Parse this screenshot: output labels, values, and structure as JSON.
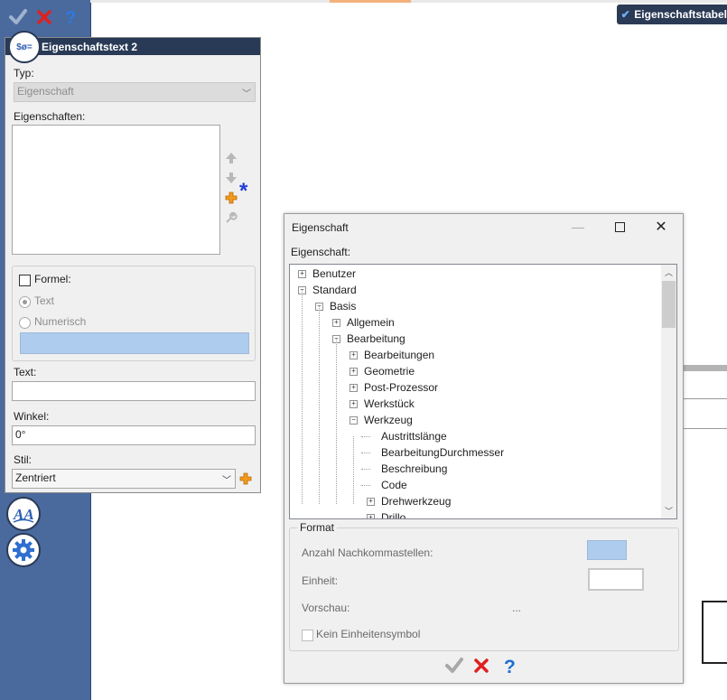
{
  "topbar": {
    "property_table_label": "Eigenschaftstabel"
  },
  "panel": {
    "title": "Eigenschaftstext 2",
    "type_label": "Typ:",
    "type_value": "Eigenschaft",
    "properties_label": "Eigenschaften:",
    "formula_label": "Formel:",
    "radio_text": "Text",
    "radio_numeric": "Numerisch",
    "text_label": "Text:",
    "text_value": "",
    "angle_label": "Winkel:",
    "angle_value": "0°",
    "style_label": "Stil:",
    "style_value": "Zentriert"
  },
  "dialog": {
    "title": "Eigenschaft",
    "property_label": "Eigenschaft:",
    "tree": [
      {
        "label": "Benutzer",
        "level": 0,
        "expander": "+"
      },
      {
        "label": "Standard",
        "level": 0,
        "expander": "-"
      },
      {
        "label": "Basis",
        "level": 1,
        "expander": "-"
      },
      {
        "label": "Allgemein",
        "level": 2,
        "expander": "+"
      },
      {
        "label": "Bearbeitung",
        "level": 2,
        "expander": "-"
      },
      {
        "label": "Bearbeitungen",
        "level": 3,
        "expander": "+"
      },
      {
        "label": "Geometrie",
        "level": 3,
        "expander": "+"
      },
      {
        "label": "Post-Prozessor",
        "level": 3,
        "expander": "+"
      },
      {
        "label": "Werkstück",
        "level": 3,
        "expander": "+"
      },
      {
        "label": "Werkzeug",
        "level": 3,
        "expander": "-"
      },
      {
        "label": "Austrittslänge",
        "level": 4,
        "expander": ""
      },
      {
        "label": "BearbeitungDurchmesser",
        "level": 4,
        "expander": ""
      },
      {
        "label": "Beschreibung",
        "level": 4,
        "expander": ""
      },
      {
        "label": "Code",
        "level": 4,
        "expander": ""
      },
      {
        "label": "Drehwerkzeug",
        "level": 4,
        "expander": "+"
      },
      {
        "label": "Drillo",
        "level": 4,
        "expander": "+"
      }
    ],
    "format": {
      "legend": "Format",
      "decimals_label": "Anzahl Nachkommastellen:",
      "unit_label": "Einheit:",
      "preview_label": "Vorschau:",
      "preview_value": "...",
      "no_unit_symbol_label": "Kein Einheitensymbol"
    }
  },
  "colors": {
    "left_strip": "#4a6a9e",
    "panel_header": "#293a56",
    "accent_blue": "#aeccee",
    "ok_green": "#8a8a8a",
    "cancel_red": "#d02020",
    "help_blue": "#1e6fd0"
  }
}
